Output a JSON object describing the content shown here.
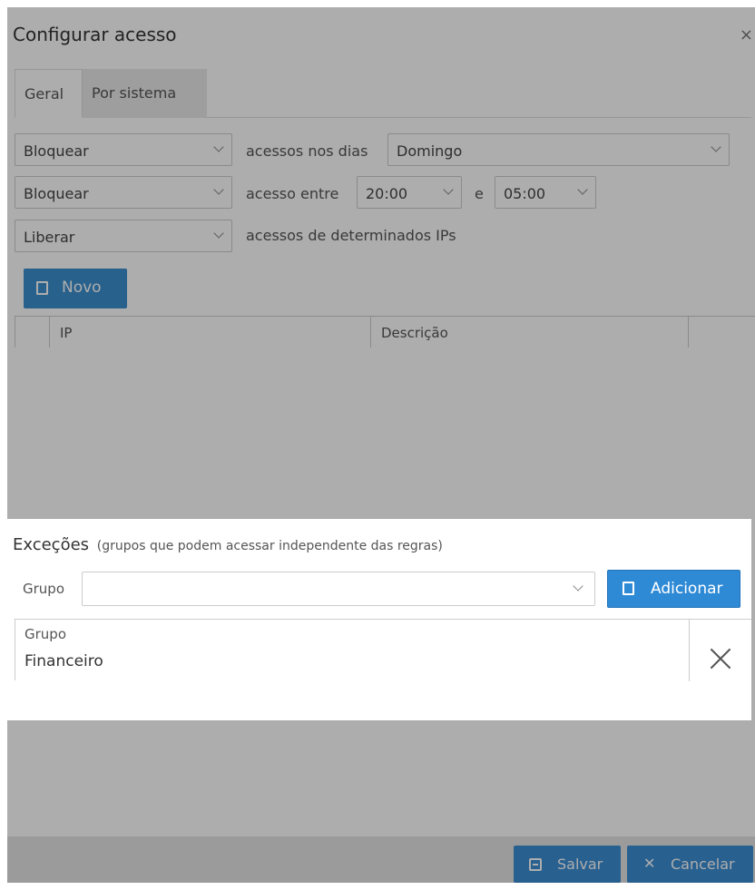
{
  "dialog": {
    "title": "Configurar acesso",
    "close_glyph": "×"
  },
  "tabs": [
    {
      "label": "Geral"
    },
    {
      "label": "Por sistema"
    }
  ],
  "rules": {
    "days": {
      "action": "Bloquear",
      "text": "acessos nos dias",
      "value": "Domingo"
    },
    "time": {
      "action": "Bloquear",
      "text": "acesso entre",
      "from": "20:00",
      "and": "e",
      "to": "05:00"
    },
    "ips": {
      "action": "Liberar",
      "text": "acessos de determinados IPs"
    }
  },
  "ip_section": {
    "new_button": "Novo",
    "columns": [
      "IP",
      "Descrição"
    ]
  },
  "exceptions": {
    "title": "Exceções",
    "subtitle": "(grupos que podem acessar independente das regras)",
    "group_label": "Grupo",
    "group_placeholder": "",
    "add_button": "Adicionar",
    "table_header": "Grupo",
    "rows": [
      {
        "group": "Financeiro"
      }
    ]
  },
  "footer": {
    "save_button": "Salvar",
    "cancel_button": "Cancelar",
    "cancel_glyph": "✕"
  },
  "icons": {
    "new": "file-icon",
    "add": "file-icon",
    "delete": "close-icon",
    "save": "save-icon",
    "cancel": "close-icon"
  },
  "colors": {
    "primary": "#3b8ed4",
    "overlay": "rgba(0,0,0,0.32)"
  }
}
